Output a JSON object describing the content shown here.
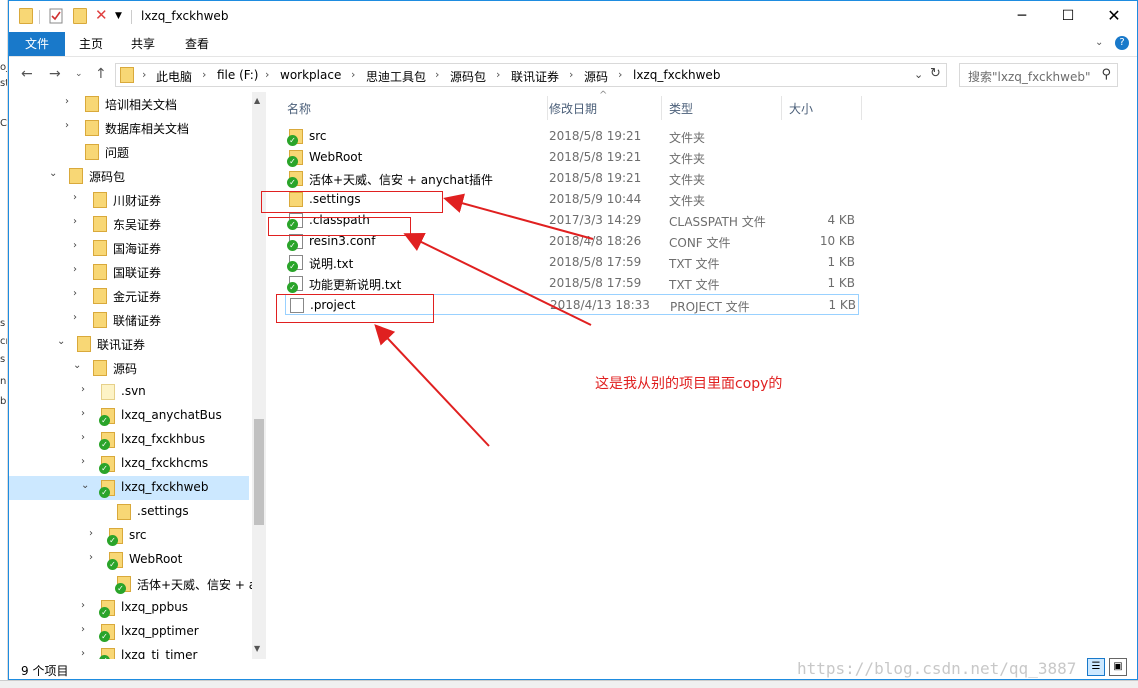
{
  "window": {
    "title": "lxzq_fxckhweb"
  },
  "ribbon": {
    "tabs": [
      "文件",
      "主页",
      "共享",
      "查看"
    ]
  },
  "address": {
    "crumbs": [
      "此电脑",
      "file (F:)",
      "workplace",
      "思迪工具包",
      "源码包",
      "联讯证券",
      "源码",
      "lxzq_fxckhweb"
    ]
  },
  "search": {
    "placeholder": "搜索\"lxzq_fxckhweb\""
  },
  "tree": [
    {
      "label": "培训相关文档",
      "chev": "›",
      "check": false,
      "pale": false,
      "selected": false
    },
    {
      "label": "数据库相关文档",
      "chev": "›",
      "check": false,
      "pale": false,
      "selected": false
    },
    {
      "label": "问题",
      "chev": "",
      "check": false,
      "pale": false,
      "selected": false
    },
    {
      "label": "源码包",
      "chev": "⌄",
      "check": false,
      "pale": false,
      "selected": false
    },
    {
      "label": "川财证券",
      "chev": "›",
      "check": false,
      "pale": false,
      "selected": false
    },
    {
      "label": "东吴证券",
      "chev": "›",
      "check": false,
      "pale": false,
      "selected": false
    },
    {
      "label": "国海证券",
      "chev": "›",
      "check": false,
      "pale": false,
      "selected": false
    },
    {
      "label": "国联证券",
      "chev": "›",
      "check": false,
      "pale": false,
      "selected": false
    },
    {
      "label": "金元证券",
      "chev": "›",
      "check": false,
      "pale": false,
      "selected": false
    },
    {
      "label": "联储证券",
      "chev": "›",
      "check": false,
      "pale": false,
      "selected": false
    },
    {
      "label": "联讯证券",
      "chev": "⌄",
      "check": false,
      "pale": false,
      "selected": false
    },
    {
      "label": "源码",
      "chev": "⌄",
      "check": false,
      "pale": false,
      "selected": false
    },
    {
      "label": ".svn",
      "chev": "›",
      "check": false,
      "pale": true,
      "selected": false
    },
    {
      "label": "lxzq_anychatBus",
      "chev": "›",
      "check": true,
      "pale": false,
      "selected": false
    },
    {
      "label": "lxzq_fxckhbus",
      "chev": "›",
      "check": true,
      "pale": false,
      "selected": false
    },
    {
      "label": "lxzq_fxckhcms",
      "chev": "›",
      "check": true,
      "pale": false,
      "selected": false
    },
    {
      "label": "lxzq_fxckhweb",
      "chev": "⌄",
      "check": true,
      "pale": false,
      "selected": true
    },
    {
      "label": ".settings",
      "chev": "",
      "check": false,
      "pale": false,
      "selected": false
    },
    {
      "label": "src",
      "chev": "›",
      "check": true,
      "pale": false,
      "selected": false
    },
    {
      "label": "WebRoot",
      "chev": "›",
      "check": true,
      "pale": false,
      "selected": false
    },
    {
      "label": "活体+天威、信安 + an",
      "chev": "",
      "check": true,
      "pale": false,
      "selected": false
    },
    {
      "label": "lxzq_ppbus",
      "chev": "›",
      "check": true,
      "pale": false,
      "selected": false
    },
    {
      "label": "lxzq_pptimer",
      "chev": "›",
      "check": true,
      "pale": false,
      "selected": false
    },
    {
      "label": "lxzq_ti_timer",
      "chev": "›",
      "check": true,
      "pale": false,
      "selected": false
    }
  ],
  "columns": {
    "name": "名称",
    "modified": "修改日期",
    "type": "类型",
    "size": "大小"
  },
  "files": [
    {
      "name": "src",
      "date": "2018/5/8 19:21",
      "type": "文件夹",
      "size": "",
      "icon": "folder-check"
    },
    {
      "name": "WebRoot",
      "date": "2018/5/8 19:21",
      "type": "文件夹",
      "size": "",
      "icon": "folder-check"
    },
    {
      "name": "活体+天威、信安 + anychat插件",
      "date": "2018/5/8 19:21",
      "type": "文件夹",
      "size": "",
      "icon": "folder-check"
    },
    {
      "name": ".settings",
      "date": "2018/5/9 10:44",
      "type": "文件夹",
      "size": "",
      "icon": "folder"
    },
    {
      "name": ".classpath",
      "date": "2017/3/3 14:29",
      "type": "CLASSPATH 文件",
      "size": "4 KB",
      "icon": "file-check"
    },
    {
      "name": "resin3.conf",
      "date": "2018/4/8 18:26",
      "type": "CONF 文件",
      "size": "10 KB",
      "icon": "file-check"
    },
    {
      "name": "说明.txt",
      "date": "2018/5/8 17:59",
      "type": "TXT 文件",
      "size": "1 KB",
      "icon": "file-check"
    },
    {
      "name": "功能更新说明.txt",
      "date": "2018/5/8 17:59",
      "type": "TXT 文件",
      "size": "1 KB",
      "icon": "file-check"
    },
    {
      "name": ".project",
      "date": "2018/4/13 18:33",
      "type": "PROJECT 文件",
      "size": "1 KB",
      "icon": "file"
    }
  ],
  "status": {
    "count": "9 个项目"
  },
  "annotation": {
    "text": "这是我从别的项目里面copy的"
  },
  "watermark": "https://blog.csdn.net/qq_3887",
  "colors": {
    "accent": "#1979ca",
    "annotation": "#e02020",
    "selected": "#cce8ff"
  }
}
